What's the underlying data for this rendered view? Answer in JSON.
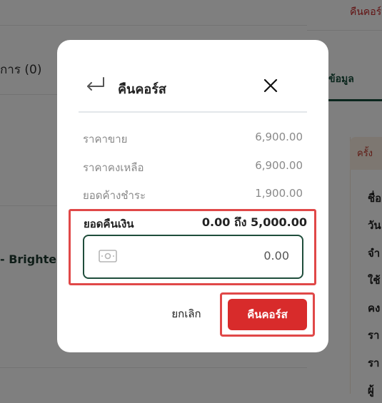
{
  "background": {
    "tab_label": "การ (0)",
    "product_label": "- Brighten",
    "top_link": "คืนคอร์ส",
    "detail_tab": "ข้อมูล",
    "card_header": "ครั้ง",
    "detail_rows": [
      "ชื่อ",
      "วัน",
      "จำ",
      "ใช้",
      "คง",
      "รา",
      "รา",
      "ผู้"
    ]
  },
  "modal": {
    "title": "คืนคอร์ส",
    "info": [
      {
        "label": "ราคาขาย",
        "value": "6,900.00"
      },
      {
        "label": "ราคาคงเหลือ",
        "value": "6,900.00"
      },
      {
        "label": "ยอดค้างชำระ",
        "value": "1,900.00"
      }
    ],
    "refund": {
      "label": "ยอดคืนเงิน",
      "range": "0.00 ถึง 5,000.00",
      "input_value": "0.00"
    },
    "cancel_label": "ยกเลิก",
    "submit_label": "คืนคอร์ส"
  },
  "colors": {
    "primary_red": "#d82b2b",
    "highlight_red": "#e04848",
    "dark_green": "#1f4d3b"
  },
  "icons": [
    "back-arrow-icon",
    "close-icon",
    "cash-icon"
  ]
}
